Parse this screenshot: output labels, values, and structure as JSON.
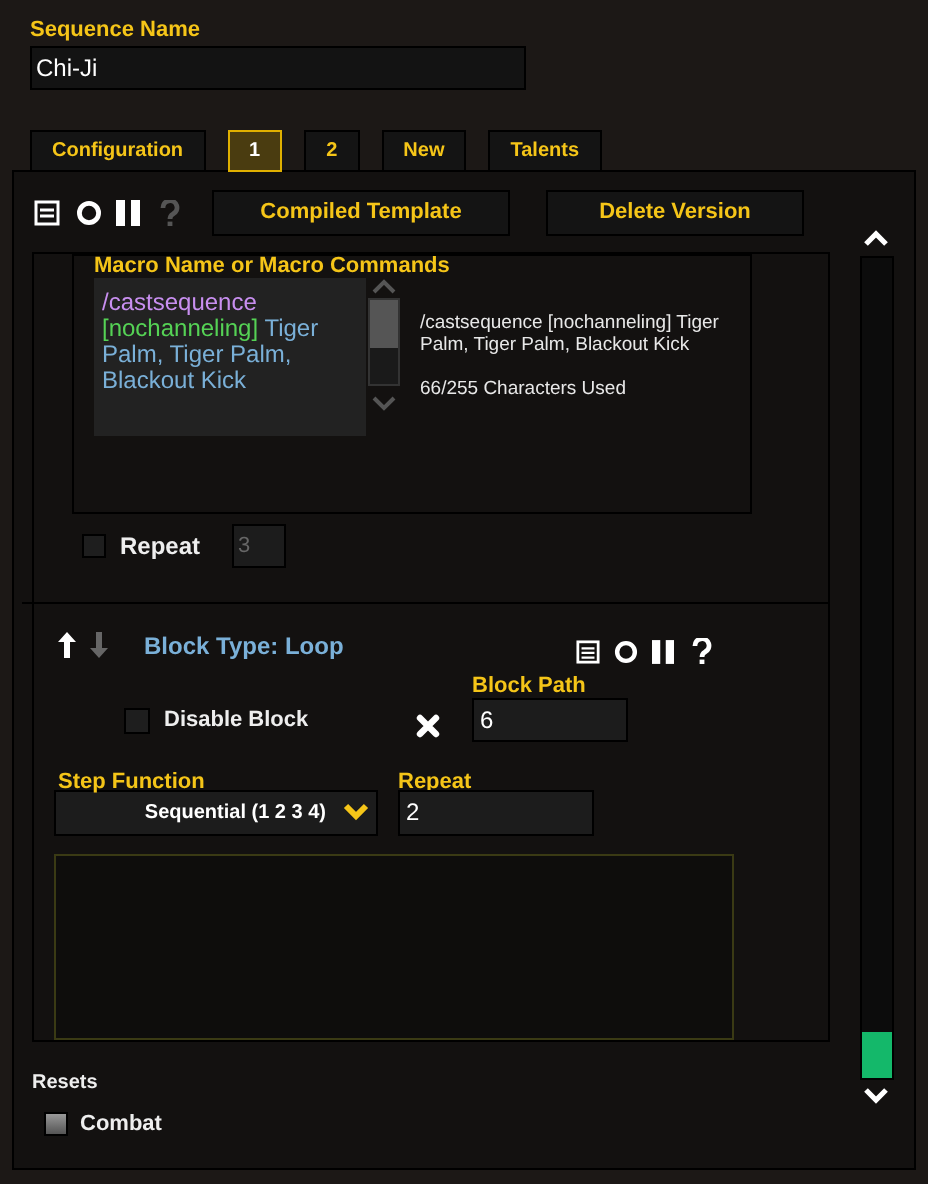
{
  "sequence_name": {
    "label": "Sequence Name",
    "value": "Chi-Ji"
  },
  "tabs": [
    {
      "label": "Configuration",
      "selected": false
    },
    {
      "label": "1",
      "selected": true
    },
    {
      "label": "2",
      "selected": false
    },
    {
      "label": "New",
      "selected": false
    },
    {
      "label": "Talents",
      "selected": false
    }
  ],
  "toolbar": {
    "buttons": [
      "Compiled Template",
      "Delete Version"
    ]
  },
  "macro": {
    "label": "Macro Name or Macro Commands",
    "segments": [
      {
        "kind": "command",
        "text": "/castsequence"
      },
      {
        "kind": "condition",
        "text": "[nochanneling]"
      },
      {
        "kind": "spell",
        "text": "Tiger Palm, Tiger Palm, Blackout Kick"
      }
    ],
    "preview": "/castsequence [nochanneling] Tiger Palm, Tiger Palm, Blackout Kick",
    "count": "66/255 Characters Used",
    "repeat": {
      "label": "Repeat",
      "checked": false,
      "placeholder": "3"
    }
  },
  "block": {
    "title": "Block Type: Loop",
    "disable": {
      "label": "Disable Block",
      "checked": false
    },
    "path": {
      "label": "Block Path",
      "value": "6"
    },
    "step_function": {
      "label": "Step Function",
      "value": "Sequential (1 2 3 4)"
    },
    "repeat": {
      "label": "Repeat",
      "value": "2"
    }
  },
  "resets": {
    "label": "Resets",
    "options": [
      {
        "label": "Combat",
        "checked": false
      }
    ]
  }
}
